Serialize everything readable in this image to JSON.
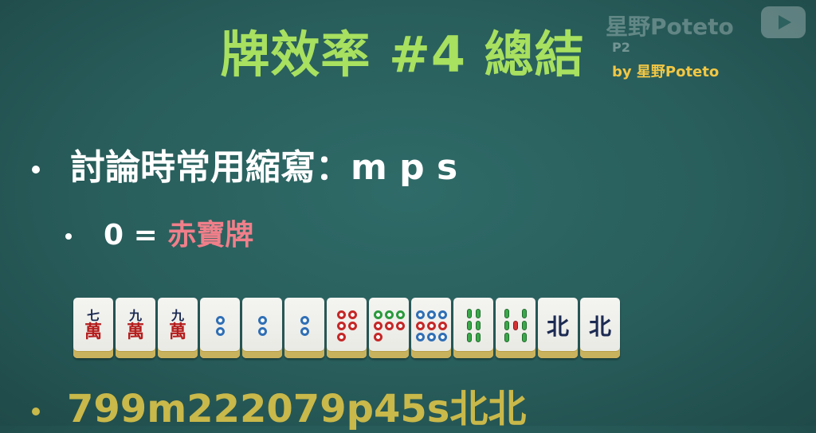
{
  "title": "牌效率 #4 總結",
  "watermark": "星野Poteto",
  "page": "P2",
  "byline": "by 星野Poteto",
  "bullets": {
    "line1": "討論時常用縮寫：m p s",
    "line2_prefix": "0 = ",
    "line2_highlight": "赤寶牌",
    "line3": "799m222079p45s北北"
  },
  "tiles": [
    {
      "kind": "man",
      "top": "七",
      "bottom": "萬"
    },
    {
      "kind": "man",
      "top": "九",
      "bottom": "萬"
    },
    {
      "kind": "man",
      "top": "九",
      "bottom": "萬"
    },
    {
      "kind": "pin",
      "value": 2
    },
    {
      "kind": "pin",
      "value": 2
    },
    {
      "kind": "pin",
      "value": 2
    },
    {
      "kind": "pin",
      "value": 5,
      "red": true
    },
    {
      "kind": "pin",
      "value": 7
    },
    {
      "kind": "pin",
      "value": 9
    },
    {
      "kind": "sou",
      "value": 4
    },
    {
      "kind": "sou",
      "value": 5
    },
    {
      "kind": "honor",
      "label": "北"
    },
    {
      "kind": "honor",
      "label": "北"
    }
  ],
  "colors": {
    "title": "#a8e05f",
    "highlight": "#f07f8a",
    "notation": "#c9b84a",
    "byline": "#f2c744"
  }
}
